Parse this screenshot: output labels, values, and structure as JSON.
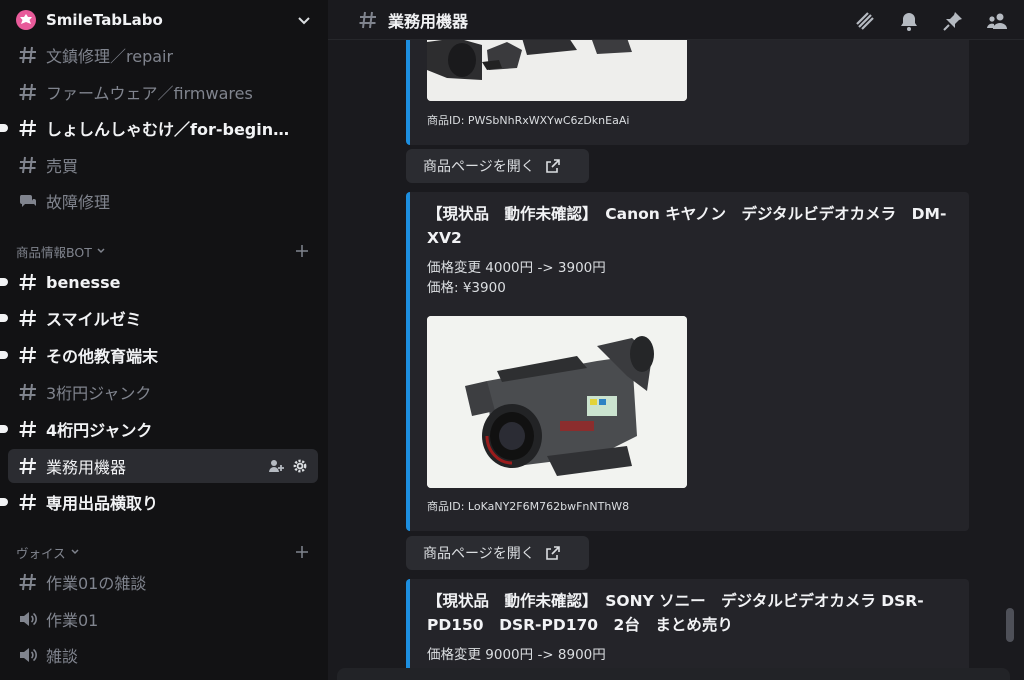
{
  "server": {
    "name": "SmileTabLabo"
  },
  "channels_top": [
    {
      "label": "文鎮修理／repair",
      "unread": false
    },
    {
      "label": "ファームウェア／firmwares",
      "unread": false
    },
    {
      "label": "しょしんしゃむけ／for-beginn...",
      "unread": true
    },
    {
      "label": "売買",
      "unread": false
    },
    {
      "label": "故障修理",
      "unread": false,
      "type": "forum"
    }
  ],
  "categories": {
    "bot": {
      "label": "商品情報BOT"
    },
    "voice": {
      "label": "ヴォイス"
    }
  },
  "bot_channels": [
    {
      "label": "benesse",
      "unread": true
    },
    {
      "label": "スマイルゼミ",
      "unread": true
    },
    {
      "label": "その他教育端末",
      "unread": true
    },
    {
      "label": "3桁円ジャンク",
      "unread": false
    },
    {
      "label": "4桁円ジャンク",
      "unread": true
    },
    {
      "label": "業務用機器",
      "unread": false,
      "selected": true
    },
    {
      "label": "専用出品横取り",
      "unread": true
    }
  ],
  "voice_channels": [
    {
      "label": "作業01の雑談",
      "type": "text"
    },
    {
      "label": "作業01",
      "type": "voice"
    },
    {
      "label": "雑談",
      "type": "voice"
    }
  ],
  "topbar": {
    "title": "業務用機器"
  },
  "messages": [
    {
      "product_id": "商品ID: PWSbNhRxWXYwC6zDknEaAi",
      "button_label": "商品ページを開く"
    },
    {
      "title": "【現状品　動作未確認】　Canon キヤノン　デジタルビデオカメラ　DM-XV2",
      "price_change": "価格変更 4000円 -> 3900円",
      "price": "価格: ¥3900",
      "product_id": "商品ID: LoKaNY2F6M762bwFnNThW8",
      "button_label": "商品ページを開く"
    },
    {
      "title": "【現状品　動作未確認】　SONY ソニー　デジタルビデオカメラ DSR-PD150　DSR-PD170　2台　まとめ売り",
      "price_change": "価格変更 9000円 -> 8900円"
    }
  ],
  "colors": {
    "accent": "#1d8fe0",
    "selected_bg": "#2b2c31",
    "server_icon": "#e85b9a"
  }
}
